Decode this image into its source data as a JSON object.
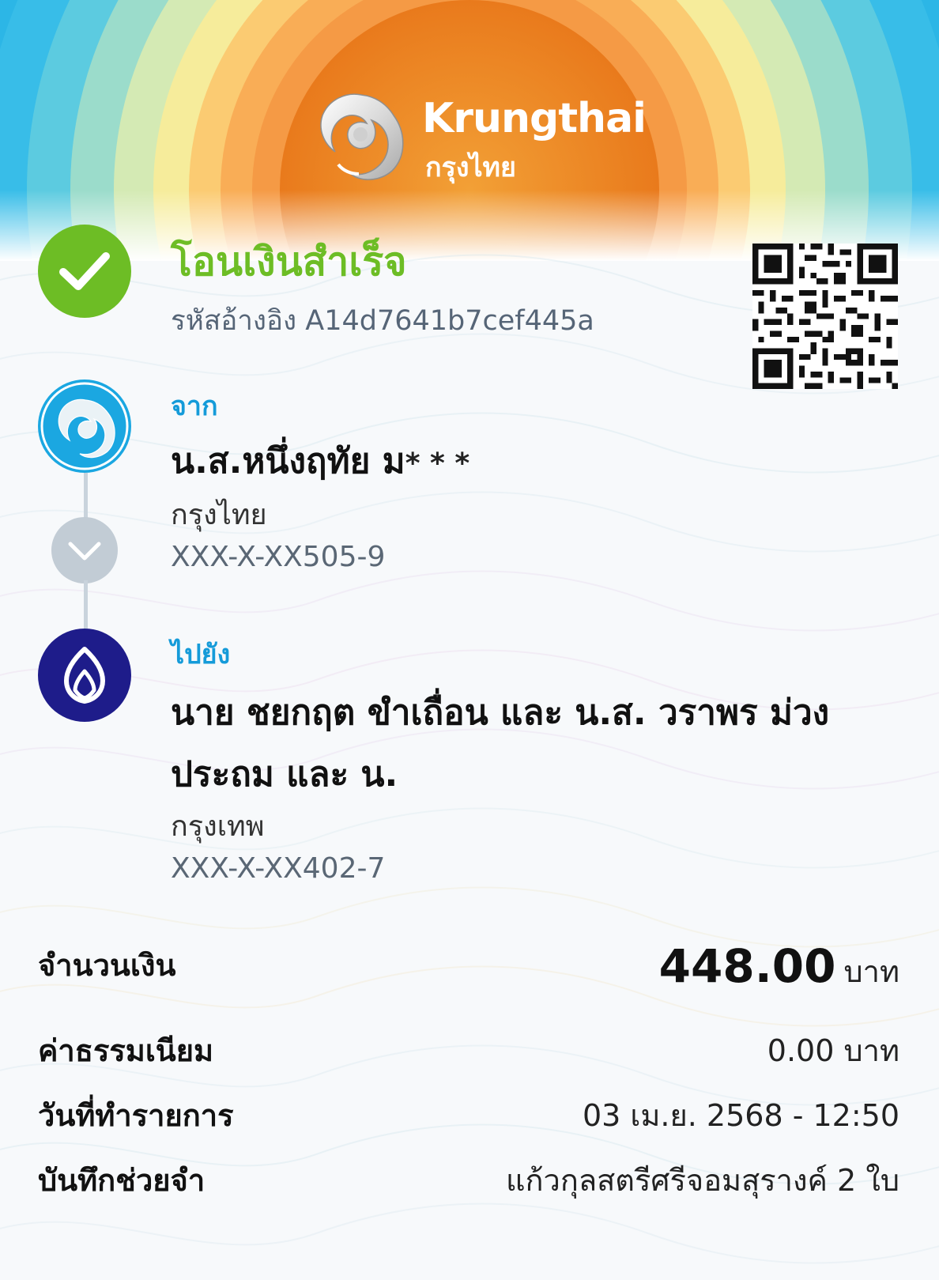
{
  "brand": {
    "name_en": "Krungthai",
    "name_th": "กรุงไทย"
  },
  "status": {
    "title": "โอนเงินสำเร็จ",
    "ref_label": "รหัสอ้างอิง",
    "ref_code": "A14d7641b7cef445a"
  },
  "from": {
    "label": "จาก",
    "name": "น.ส.หนึ่งฤทัย ม",
    "name_mask": "* * *",
    "bank": "กรุงไทย",
    "account": "XXX-X-XX505-9"
  },
  "to": {
    "label": "ไปยัง",
    "name_line1": "นาย ชยกฤต ขำเถื่อน และ น.ส. วราพร ม่วง",
    "name_line2": "ประถม และ น.",
    "bank": "กรุงเทพ",
    "account": "XXX-X-XX402-7"
  },
  "details": {
    "amount_label": "จำนวนเงิน",
    "amount_value": "448.00",
    "amount_unit": "บาท",
    "fee_label": "ค่าธรรมเนียม",
    "fee_value": "0.00 บาท",
    "date_label": "วันที่ทำรายการ",
    "date_value": "03 เม.ย. 2568 - 12:50",
    "memo_label": "บันทึกช่วยจำ",
    "memo_value": "แก้วกุลสตรีศรีจอมสุรางค์ 2 ใบ"
  },
  "colors": {
    "success_green": "#6dbd25",
    "krungthai_blue": "#1ba7e1",
    "bangkok_bank_navy": "#1e1c8a",
    "label_blue": "#159bd9"
  },
  "icons": {
    "status": "check-icon",
    "from_bank": "krungthai-bird-logo",
    "to_bank": "bangkok-bank-lotus-logo",
    "connector": "chevron-down-icon"
  }
}
